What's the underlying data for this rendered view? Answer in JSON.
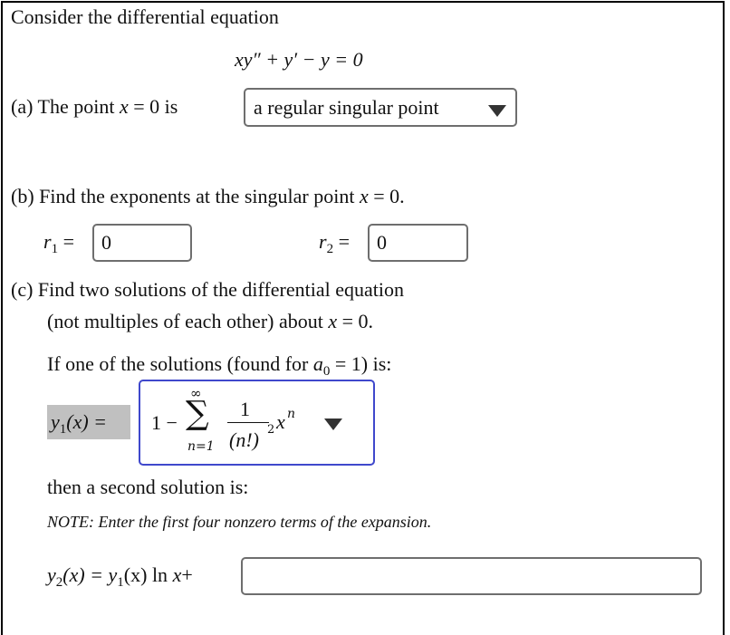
{
  "intro": "Consider the differential equation",
  "equation": "xy″ + y′ − y = 0",
  "part_a": {
    "label": "(a) The point ",
    "var": "x",
    "eq": " = 0 is",
    "select_value": "a regular singular point"
  },
  "part_b": {
    "label": "(b) Find the exponents at the singular point ",
    "var": "x",
    "eq": " = 0.",
    "r1_label": "r",
    "r1_sub": "1",
    "r1_eq": " =",
    "r1_value": "0",
    "r2_label": "r",
    "r2_sub": "2",
    "r2_eq": " =",
    "r2_value": "0"
  },
  "part_c": {
    "line1": "(c) Find two solutions of the differential equation",
    "line2_pre": "(not multiples of each other) about ",
    "line2_var": "x",
    "line2_post": " = 0.",
    "line3_pre": "If one of the solutions (found for ",
    "line3_var": "a",
    "line3_sub": "0",
    "line3_post": " = 1) is:",
    "y1_label_var": "y",
    "y1_label_sub": "1",
    "y1_label_rest": "(x) =",
    "y1_select": {
      "lead": "1 −",
      "sigma": "∑",
      "upper": "∞",
      "lower": "n=1",
      "numerator": "1",
      "denominator": "(n!)",
      "den_exp": "2",
      "power_base": "x",
      "power_exp": "n"
    },
    "then_text": "then a second solution is:",
    "note": "NOTE: Enter the first four nonzero terms of the expansion.",
    "y2_expr": {
      "y2": "y",
      "y2_sub": "2",
      "y2_rest": "(x) = ",
      "y1": "y",
      "y1_sub": "1",
      "y1_rest": "(x) ln ",
      "x": "x",
      "plus": "+"
    },
    "y2_input_value": ""
  },
  "icons": {
    "dropdown": "caret-down-icon"
  }
}
